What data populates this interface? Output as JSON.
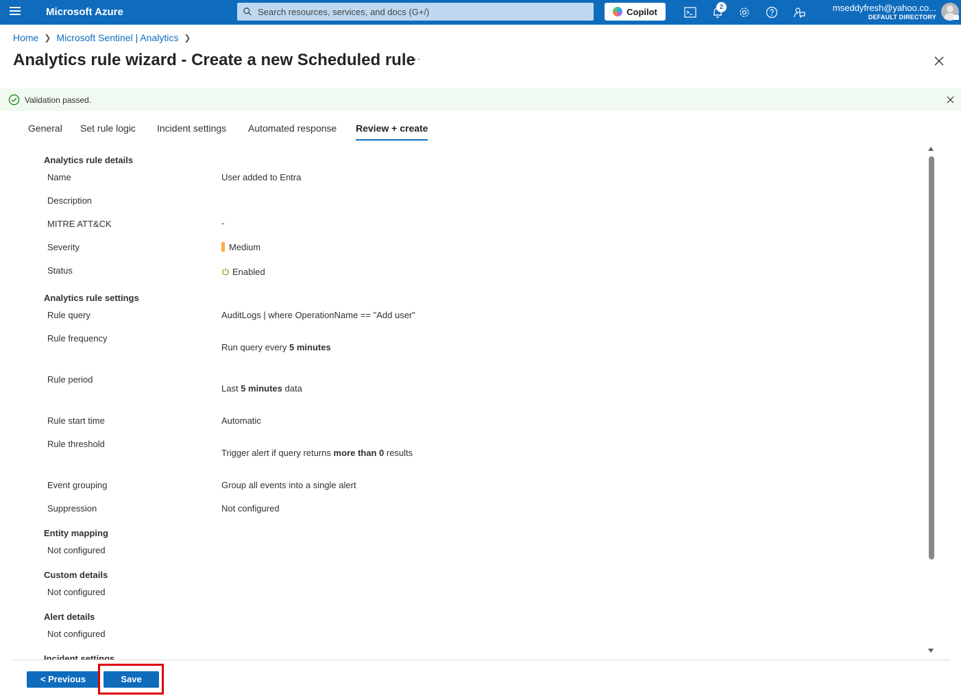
{
  "topbar": {
    "brand": "Microsoft Azure",
    "search_placeholder": "Search resources, services, and docs (G+/)",
    "copilot_label": "Copilot",
    "notification_count": "2",
    "account_email": "mseddyfresh@yahoo.co...",
    "account_directory": "DEFAULT DIRECTORY",
    "icons": [
      "menu-icon",
      "search-icon",
      "cloud-shell-icon",
      "notifications-icon",
      "settings-icon",
      "help-icon",
      "feedback-icon"
    ]
  },
  "breadcrumb": {
    "items": [
      "Home",
      "Microsoft Sentinel | Analytics"
    ]
  },
  "page": {
    "title": "Analytics rule wizard - Create a new Scheduled rule",
    "more": "···"
  },
  "banner": {
    "text": "Validation passed.",
    "status_color": "#107c10"
  },
  "tabs": [
    "General",
    "Set rule logic",
    "Incident settings",
    "Automated response",
    "Review + create"
  ],
  "active_tab": "Review + create",
  "details": {
    "analytics_rule_details": {
      "heading": "Analytics rule details",
      "name_label": "Name",
      "name_value": "User added to Entra",
      "description_label": "Description",
      "mitre_label": "MITRE ATT&CK",
      "mitre_value": "-",
      "severity_label": "Severity",
      "severity_value": "Medium",
      "severity_color": "#ffaa44",
      "status_label": "Status",
      "status_value": "Enabled"
    },
    "analytics_rule_settings": {
      "heading": "Analytics rule settings",
      "query_label": "Rule query",
      "query_value": "AuditLogs | where OperationName == \"Add user\"",
      "frequency_label": "Rule frequency",
      "frequency_prefix": "Run query every",
      "frequency_value": "5 minutes",
      "period_label": "Rule period",
      "period_prefix": "Last",
      "period_value": "5 minutes",
      "period_suffix": "data",
      "start_label": "Rule start time",
      "start_value": "Automatic",
      "threshold_label": "Rule threshold",
      "threshold_prefix": "Trigger alert if query returns",
      "threshold_value": "more than 0",
      "threshold_suffix": "results",
      "grouping_label": "Event grouping",
      "grouping_value": "Group all events into a single alert",
      "suppression_label": "Suppression",
      "suppression_value": "Not configured"
    },
    "entity_mapping": {
      "heading": "Entity mapping",
      "value": "Not configured"
    },
    "custom_details": {
      "heading": "Custom details",
      "value": "Not configured"
    },
    "alert_details": {
      "heading": "Alert details",
      "value": "Not configured"
    },
    "incident_settings": {
      "heading": "Incident settings"
    }
  },
  "footer": {
    "previous_label": "< Previous",
    "save_label": "Save",
    "highlight_color": "#e00000"
  }
}
